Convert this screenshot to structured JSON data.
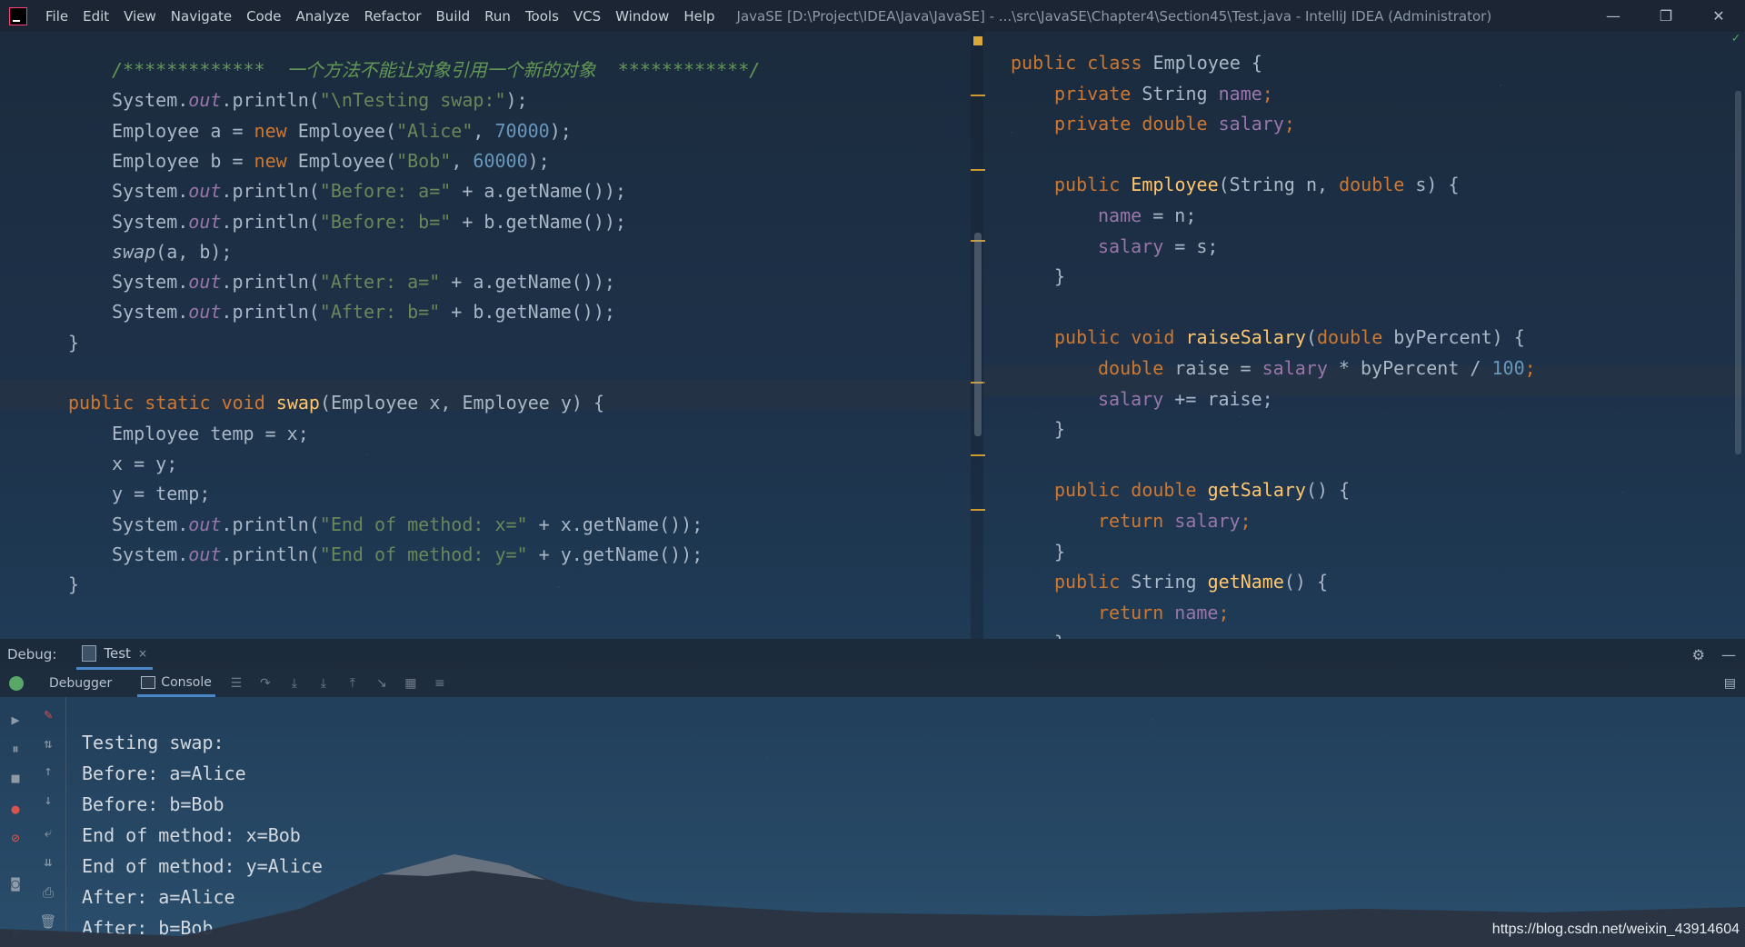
{
  "window": {
    "title": "JavaSE [D:\\Project\\IDEA\\Java\\JavaSE] - ...\\src\\JavaSE\\Chapter4\\Section45\\Test.java - IntelliJ IDEA (Administrator)",
    "menu": [
      "File",
      "Edit",
      "View",
      "Navigate",
      "Code",
      "Analyze",
      "Refactor",
      "Build",
      "Run",
      "Tools",
      "VCS",
      "Window",
      "Help"
    ],
    "controls": {
      "minimize": "—",
      "restore": "❐",
      "close": "✕"
    }
  },
  "left_editor": {
    "lines": [
      {
        "segments": [
          [
            "comment",
            "/*************  一个方法不能让对象引用一个新的对象  ************/"
          ]
        ]
      },
      {
        "segments": [
          [
            "plain",
            "System."
          ],
          [
            "static-field",
            "out"
          ],
          [
            "plain",
            ".println("
          ],
          [
            "str",
            "\"\\nTesting swap:\""
          ],
          [
            "plain",
            ");"
          ]
        ]
      },
      {
        "segments": [
          [
            "plain",
            "Employee a = "
          ],
          [
            "kw",
            "new"
          ],
          [
            "plain",
            " Employee("
          ],
          [
            "str",
            "\"Alice\""
          ],
          [
            "plain",
            ", "
          ],
          [
            "num",
            "70000"
          ],
          [
            "plain",
            ");"
          ]
        ]
      },
      {
        "segments": [
          [
            "plain",
            "Employee b = "
          ],
          [
            "kw",
            "new"
          ],
          [
            "plain",
            " Employee("
          ],
          [
            "str",
            "\"Bob\""
          ],
          [
            "plain",
            ", "
          ],
          [
            "num",
            "60000"
          ],
          [
            "plain",
            ");"
          ]
        ]
      },
      {
        "segments": [
          [
            "plain",
            "System."
          ],
          [
            "static-field",
            "out"
          ],
          [
            "plain",
            ".println("
          ],
          [
            "str",
            "\"Before: a=\""
          ],
          [
            "plain",
            " + a.getName());"
          ]
        ]
      },
      {
        "segments": [
          [
            "plain",
            "System."
          ],
          [
            "static-field",
            "out"
          ],
          [
            "plain",
            ".println("
          ],
          [
            "str",
            "\"Before: b=\""
          ],
          [
            "plain",
            " + b.getName());"
          ]
        ]
      },
      {
        "segments": [
          [
            "ital",
            "swap"
          ],
          [
            "plain",
            "(a, b);"
          ]
        ]
      },
      {
        "segments": [
          [
            "plain",
            "System."
          ],
          [
            "static-field",
            "out"
          ],
          [
            "plain",
            ".println("
          ],
          [
            "str",
            "\"After: a=\""
          ],
          [
            "plain",
            " + a.getName());"
          ]
        ]
      },
      {
        "segments": [
          [
            "plain",
            "System."
          ],
          [
            "static-field",
            "out"
          ],
          [
            "plain",
            ".println("
          ],
          [
            "str",
            "\"After: b=\""
          ],
          [
            "plain",
            " + b.getName());"
          ]
        ]
      },
      {
        "segments": [
          [
            "plain",
            "}"
          ]
        ]
      },
      {
        "segments": [
          [
            "plain",
            ""
          ]
        ]
      },
      {
        "segments": [
          [
            "kw",
            "public static void "
          ],
          [
            "fn",
            "swap"
          ],
          [
            "plain",
            "(Employee x, Employee y) {"
          ]
        ]
      },
      {
        "segments": [
          [
            "plain",
            "Employee temp = x;"
          ]
        ]
      },
      {
        "segments": [
          [
            "plain",
            "x = y;"
          ]
        ]
      },
      {
        "segments": [
          [
            "plain",
            "y = temp;"
          ]
        ]
      },
      {
        "segments": [
          [
            "plain",
            "System."
          ],
          [
            "static-field",
            "out"
          ],
          [
            "plain",
            ".println("
          ],
          [
            "str",
            "\"End of method: x=\""
          ],
          [
            "plain",
            " + x.getName());"
          ]
        ]
      },
      {
        "segments": [
          [
            "plain",
            "System."
          ],
          [
            "static-field",
            "out"
          ],
          [
            "plain",
            ".println("
          ],
          [
            "str",
            "\"End of method: y=\""
          ],
          [
            "plain",
            " + y.getName());"
          ]
        ]
      },
      {
        "segments": [
          [
            "plain",
            "}"
          ]
        ]
      }
    ]
  },
  "right_editor": {
    "lines": [
      {
        "segments": [
          [
            "kw",
            "public class "
          ],
          [
            "plain",
            "Employee {"
          ]
        ]
      },
      {
        "segments": [
          [
            "kw",
            "private "
          ],
          [
            "plain",
            "String "
          ],
          [
            "field",
            "name"
          ],
          [
            "kw",
            ";"
          ]
        ]
      },
      {
        "segments": [
          [
            "kw",
            "private double "
          ],
          [
            "field",
            "salary"
          ],
          [
            "kw",
            ";"
          ]
        ]
      },
      {
        "segments": [
          [
            "plain",
            ""
          ]
        ]
      },
      {
        "segments": [
          [
            "kw",
            "public "
          ],
          [
            "fn",
            "Employee"
          ],
          [
            "plain",
            "(String n, "
          ],
          [
            "kw",
            "double "
          ],
          [
            "plain",
            "s) {"
          ]
        ]
      },
      {
        "segments": [
          [
            "field",
            "name"
          ],
          [
            "plain",
            " = n;"
          ]
        ]
      },
      {
        "segments": [
          [
            "field",
            "salary"
          ],
          [
            "plain",
            " = s;"
          ]
        ]
      },
      {
        "segments": [
          [
            "plain",
            "}"
          ]
        ]
      },
      {
        "segments": [
          [
            "plain",
            ""
          ]
        ]
      },
      {
        "segments": [
          [
            "kw",
            "public void "
          ],
          [
            "fn",
            "raiseSalary"
          ],
          [
            "plain",
            "("
          ],
          [
            "kw",
            "double "
          ],
          [
            "plain",
            "byPercent) {"
          ]
        ]
      },
      {
        "segments": [
          [
            "kw",
            "double "
          ],
          [
            "plain",
            "raise = "
          ],
          [
            "field",
            "salary"
          ],
          [
            "plain",
            " * byPercent / "
          ],
          [
            "num",
            "100"
          ],
          [
            "kw",
            ";"
          ]
        ]
      },
      {
        "segments": [
          [
            "field",
            "salary"
          ],
          [
            "plain",
            " += raise;"
          ]
        ]
      },
      {
        "segments": [
          [
            "plain",
            "}"
          ]
        ]
      },
      {
        "segments": [
          [
            "plain",
            ""
          ]
        ]
      },
      {
        "segments": [
          [
            "kw",
            "public double "
          ],
          [
            "fn",
            "getSalary"
          ],
          [
            "plain",
            "() {"
          ]
        ]
      },
      {
        "segments": [
          [
            "kw",
            "return "
          ],
          [
            "field",
            "salary"
          ],
          [
            "kw",
            ";"
          ]
        ]
      },
      {
        "segments": [
          [
            "plain",
            "}"
          ]
        ]
      },
      {
        "segments": [
          [
            "kw",
            "public "
          ],
          [
            "plain",
            "String "
          ],
          [
            "fn",
            "getName"
          ],
          [
            "plain",
            "() {"
          ]
        ]
      },
      {
        "segments": [
          [
            "kw",
            "return "
          ],
          [
            "field",
            "name"
          ],
          [
            "kw",
            ";"
          ]
        ]
      },
      {
        "segments": [
          [
            "plain",
            "}"
          ]
        ]
      }
    ]
  },
  "debug": {
    "label": "Debug:",
    "tab": "Test",
    "tab_close": "×",
    "subtabs": {
      "debugger": "Debugger",
      "console": "Console"
    },
    "console_output": [
      "Testing swap:",
      "Before: a=Alice",
      "Before: b=Bob",
      "End of method: x=Bob",
      "End of method: y=Alice",
      "After: a=Alice",
      "After: b=Bob"
    ]
  },
  "watermark": "https://blog.csdn.net/weixin_43914604"
}
